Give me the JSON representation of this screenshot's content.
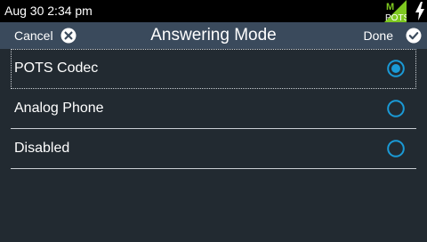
{
  "status_bar": {
    "datetime": "Aug 30 2:34 pm",
    "badge_letter": "M",
    "badge_text": "POTS",
    "badge_color": "#7ec820"
  },
  "header": {
    "cancel_label": "Cancel",
    "title": "Answering Mode",
    "done_label": "Done",
    "background": "#3a4a5c"
  },
  "accent_color": "#1a9ad6",
  "options": [
    {
      "label": "POTS Codec",
      "selected": true
    },
    {
      "label": "Analog Phone",
      "selected": false
    },
    {
      "label": "Disabled",
      "selected": false
    }
  ]
}
